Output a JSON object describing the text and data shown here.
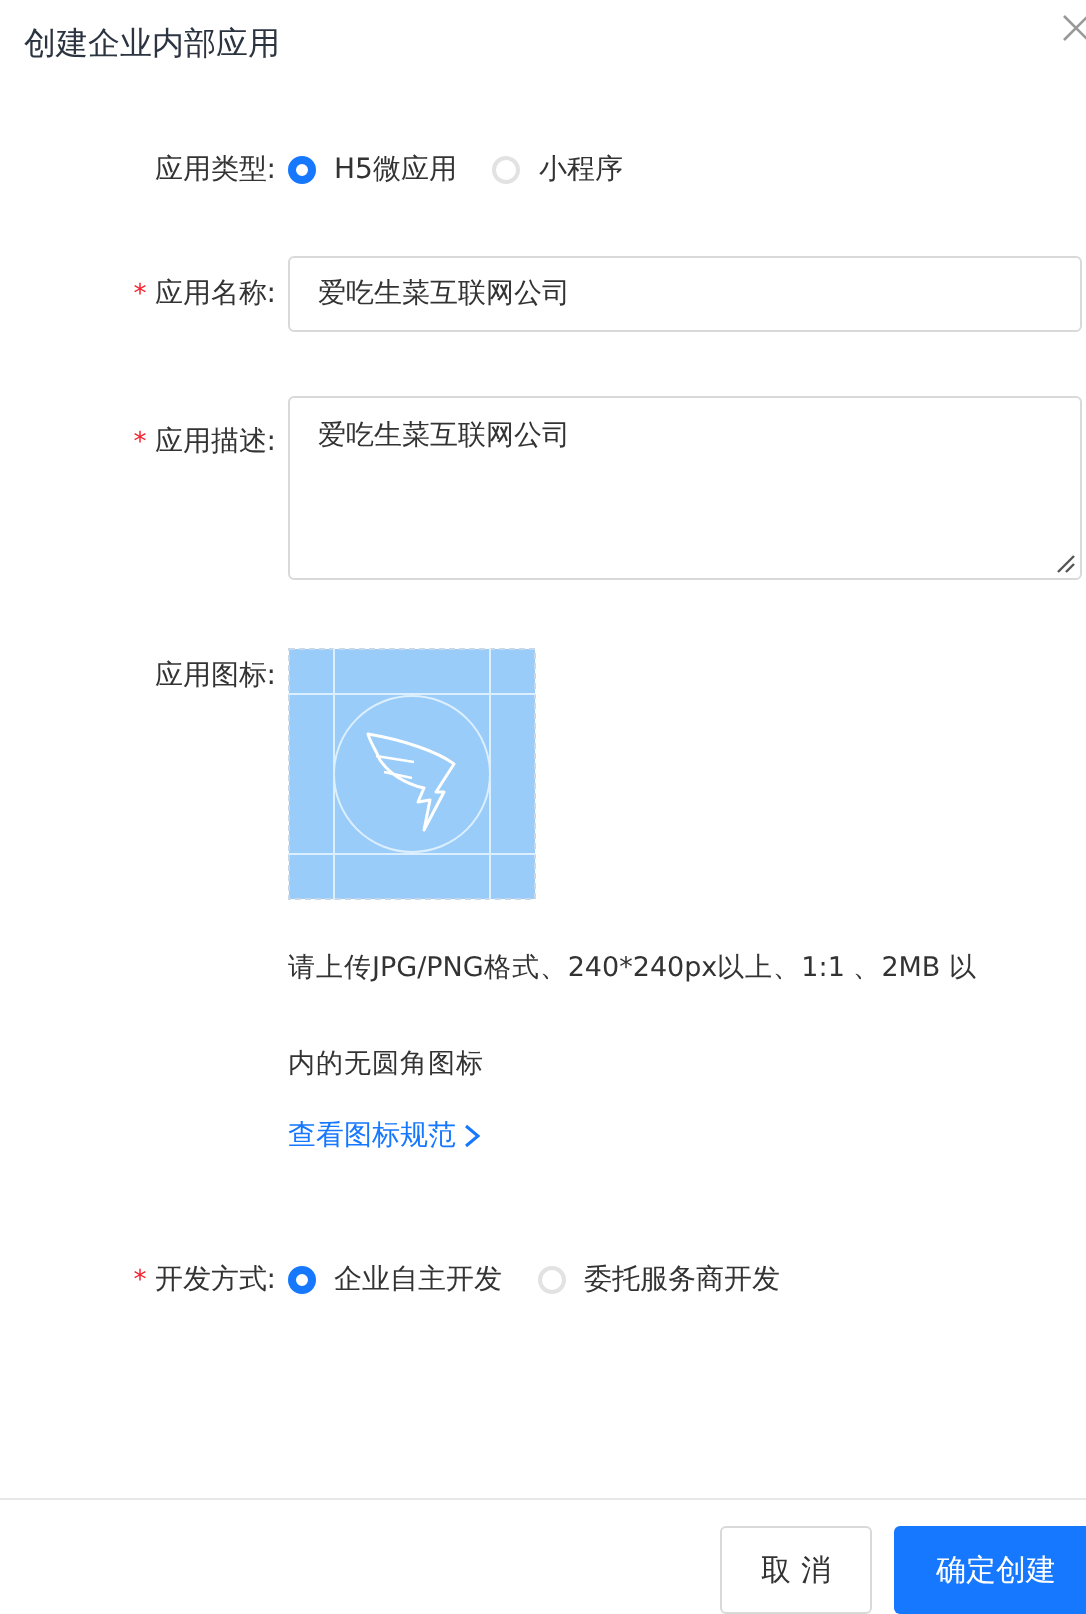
{
  "dialog": {
    "title": "创建企业内部应用"
  },
  "fields": [
    {
      "kind": "radio",
      "label": "应用类型:",
      "options": [
        {
          "label": "H5微应用",
          "selected": true
        },
        {
          "label": "小程序",
          "selected": false
        }
      ]
    },
    {
      "kind": "input",
      "label": "应用名称:",
      "required_mark": "*",
      "value": "爱吃生菜互联网公司"
    },
    {
      "kind": "textarea",
      "label": "应用描述:",
      "required_mark": "*",
      "value": "爱吃生菜互联网公司"
    },
    {
      "kind": "icon",
      "label": "应用图标:",
      "hint": "请上传JPG/PNG格式、240*240px以上、1:1 、2MB 以内的无圆角图标",
      "link": "查看图标规范"
    },
    {
      "kind": "radio",
      "label": "开发方式:",
      "required_mark": "*",
      "options": [
        {
          "label": "企业自主开发",
          "selected": true
        },
        {
          "label": "委托服务商开发",
          "selected": false
        }
      ]
    }
  ],
  "buttons": [
    {
      "label": "取 消",
      "kind": "secondary"
    },
    {
      "label": "确定创建",
      "kind": "primary"
    }
  ]
}
